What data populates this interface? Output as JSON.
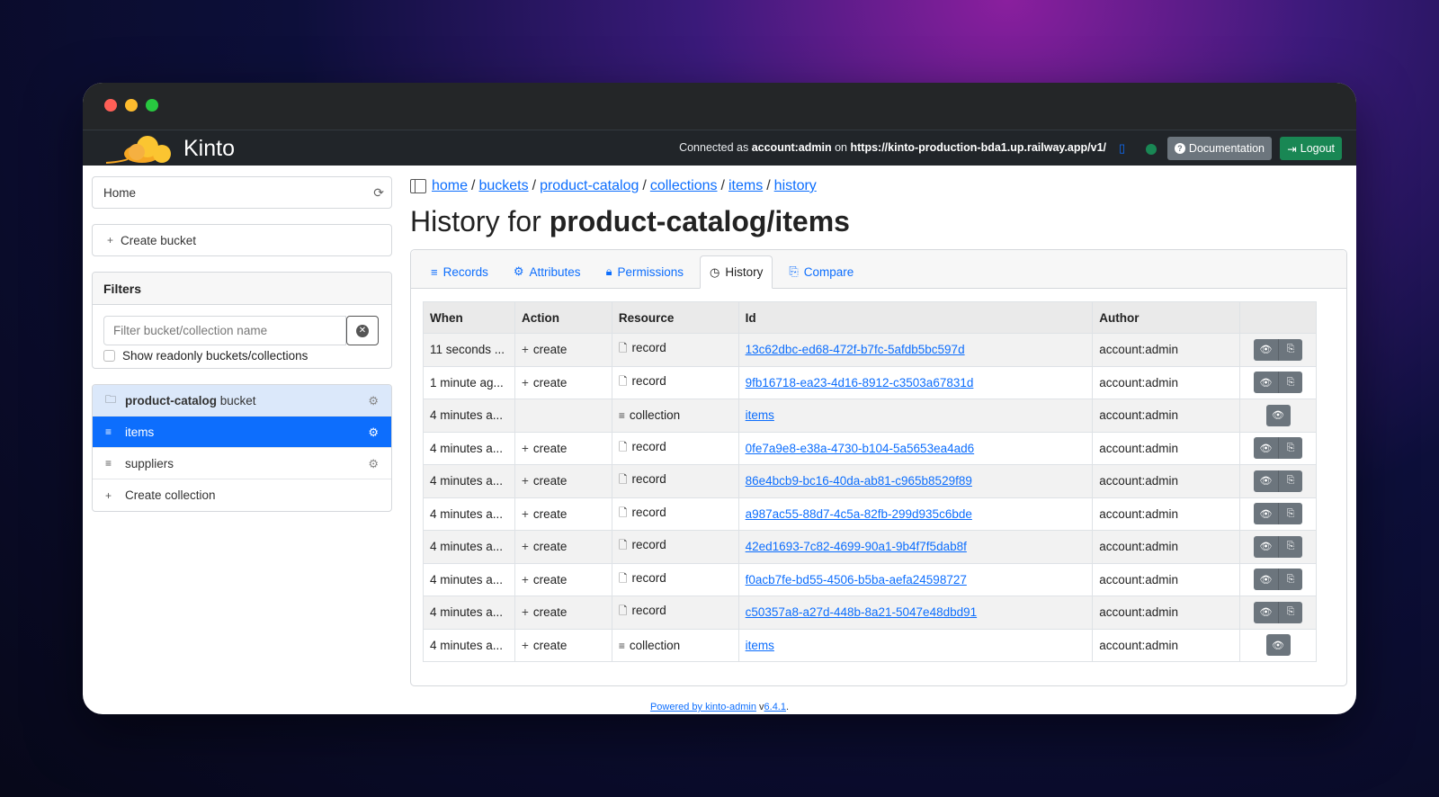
{
  "navbar": {
    "brand": "Kinto",
    "connected_prefix": "Connected as",
    "user": "account:admin",
    "on": "on",
    "server": "https://kinto-production-bda1.up.railway.app/v1/",
    "documentation_label": "Documentation",
    "logout_label": "Logout"
  },
  "sidebar": {
    "home_label": "Home",
    "create_bucket_label": "Create bucket",
    "filters_title": "Filters",
    "filter_placeholder": "Filter bucket/collection name",
    "readonly_label": "Show readonly buckets/collections",
    "bucket_name": "product-catalog",
    "bucket_suffix": "bucket",
    "collections": [
      "items",
      "suppliers"
    ],
    "create_collection_label": "Create collection"
  },
  "breadcrumb": [
    "home",
    "buckets",
    "product-catalog",
    "collections",
    "items",
    "history"
  ],
  "page_title": {
    "prefix": "History for",
    "target": "product-catalog/items"
  },
  "tabs": [
    "Records",
    "Attributes",
    "Permissions",
    "History",
    "Compare"
  ],
  "table": {
    "headers": [
      "When",
      "Action",
      "Resource",
      "Id",
      "Author",
      ""
    ],
    "rows": [
      {
        "when": "11 seconds ...",
        "action": "create",
        "resource": "record",
        "id": "13c62dbc-ed68-472f-b7fc-5afdb5bc597d",
        "author": "account:admin"
      },
      {
        "when": "1 minute ag...",
        "action": "create",
        "resource": "record",
        "id": "9fb16718-ea23-4d16-8912-c3503a67831d",
        "author": "account:admin"
      },
      {
        "when": "4 minutes a...",
        "action": "",
        "resource": "collection",
        "id": "items",
        "author": "account:admin"
      },
      {
        "when": "4 minutes a...",
        "action": "create",
        "resource": "record",
        "id": "0fe7a9e8-e38a-4730-b104-5a5653ea4ad6",
        "author": "account:admin"
      },
      {
        "when": "4 minutes a...",
        "action": "create",
        "resource": "record",
        "id": "86e4bcb9-bc16-40da-ab81-c965b8529f89",
        "author": "account:admin"
      },
      {
        "when": "4 minutes a...",
        "action": "create",
        "resource": "record",
        "id": "a987ac55-88d7-4c5a-82fb-299d935c6bde",
        "author": "account:admin"
      },
      {
        "when": "4 minutes a...",
        "action": "create",
        "resource": "record",
        "id": "42ed1693-7c82-4699-90a1-9b4f7f5dab8f",
        "author": "account:admin"
      },
      {
        "when": "4 minutes a...",
        "action": "create",
        "resource": "record",
        "id": "f0acb7fe-bd55-4506-b5ba-aefa24598727",
        "author": "account:admin"
      },
      {
        "when": "4 minutes a...",
        "action": "create",
        "resource": "record",
        "id": "c50357a8-a27d-448b-8a21-5047e48dbd91",
        "author": "account:admin"
      },
      {
        "when": "4 minutes a...",
        "action": "create",
        "resource": "collection",
        "id": "items",
        "author": "account:admin"
      }
    ]
  },
  "footer": {
    "powered": "Powered by kinto-admin",
    "v": "v",
    "version": "6.4.1",
    "dot": "."
  },
  "colors": {
    "primary": "#0d6efd",
    "success": "#198754",
    "secondary": "#6c757d",
    "navbar": "#212529"
  }
}
